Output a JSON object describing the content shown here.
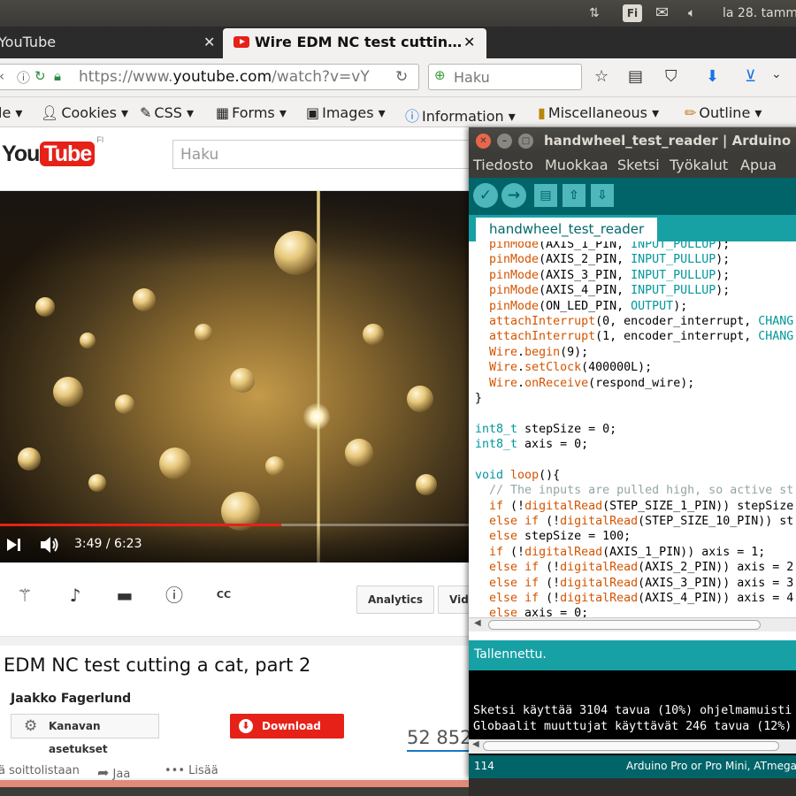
{
  "top_panel": {
    "keyboard_layout": "Fi",
    "clock": "la 28. tamm",
    "icons": [
      "network-arrows-icon",
      "mail-icon",
      "volume-icon"
    ]
  },
  "browser": {
    "tabs": [
      {
        "label": "YouTube",
        "active": false
      },
      {
        "label": "Wire EDM NC test cuttin…",
        "active": true
      }
    ],
    "url_prefix": "https://www.",
    "url_domain": "youtube.com",
    "url_rest": "/watch?v=vY",
    "search_placeholder": "Haku",
    "dev_toolbar": [
      {
        "label": "le",
        "icon": ""
      },
      {
        "label": "Cookies",
        "icon": "cookie-icon"
      },
      {
        "label": "CSS",
        "icon": "css-icon"
      },
      {
        "label": "Forms",
        "icon": "forms-icon"
      },
      {
        "label": "Images",
        "icon": "images-icon"
      },
      {
        "label": "Information",
        "icon": "info-icon"
      },
      {
        "label": "Miscellaneous",
        "icon": "misc-icon"
      },
      {
        "label": "Outline",
        "icon": "outline-icon"
      }
    ]
  },
  "youtube": {
    "logo_you": "You",
    "logo_tube": "Tube",
    "logo_region": "FI",
    "search_placeholder": "Haku",
    "player": {
      "time": "3:49 / 6:23",
      "progress_fraction": 0.6
    },
    "action_buttons": {
      "analytics": "Analytics",
      "video_partial": "Vide"
    },
    "video_title": "EDM NC test cutting a cat, part 2",
    "channel_name": "Jaakko Fagerlund",
    "channel_settings": "Kanavan asetukset",
    "download": "Download",
    "view_count": "52 852",
    "bottom_actions": {
      "playlist": "ä soittolistaan",
      "share": "Jaa",
      "more": "Lisää"
    },
    "accent_color": "#e62117"
  },
  "arduino": {
    "window_title": "handwheel_test_reader | Arduino",
    "menu": [
      "Tiedosto",
      "Muokkaa",
      "Sketsi",
      "Työkalut",
      "Apua"
    ],
    "tab_name": "handwheel_test_reader",
    "code_lines": [
      [
        {
          "t": "  "
        },
        {
          "t": "pinMode",
          "c": "fn"
        },
        {
          "t": "(AXIS_1_PIN, "
        },
        {
          "t": "INPUT_PULLUP",
          "c": "kw"
        },
        {
          "t": ");"
        }
      ],
      [
        {
          "t": "  "
        },
        {
          "t": "pinMode",
          "c": "fn"
        },
        {
          "t": "(AXIS_2_PIN, "
        },
        {
          "t": "INPUT_PULLUP",
          "c": "kw"
        },
        {
          "t": ");"
        }
      ],
      [
        {
          "t": "  "
        },
        {
          "t": "pinMode",
          "c": "fn"
        },
        {
          "t": "(AXIS_3_PIN, "
        },
        {
          "t": "INPUT_PULLUP",
          "c": "kw"
        },
        {
          "t": ");"
        }
      ],
      [
        {
          "t": "  "
        },
        {
          "t": "pinMode",
          "c": "fn"
        },
        {
          "t": "(AXIS_4_PIN, "
        },
        {
          "t": "INPUT_PULLUP",
          "c": "kw"
        },
        {
          "t": ");"
        }
      ],
      [
        {
          "t": "  "
        },
        {
          "t": "pinMode",
          "c": "fn"
        },
        {
          "t": "(ON_LED_PIN, "
        },
        {
          "t": "OUTPUT",
          "c": "kw"
        },
        {
          "t": ");"
        }
      ],
      [
        {
          "t": "  "
        },
        {
          "t": "attachInterrupt",
          "c": "fn"
        },
        {
          "t": "(0, encoder_interrupt, "
        },
        {
          "t": "CHANG",
          "c": "kw"
        }
      ],
      [
        {
          "t": "  "
        },
        {
          "t": "attachInterrupt",
          "c": "fn"
        },
        {
          "t": "(1, encoder_interrupt, "
        },
        {
          "t": "CHANG",
          "c": "kw"
        }
      ],
      [
        {
          "t": "  "
        },
        {
          "t": "Wire",
          "c": "fn"
        },
        {
          "t": "."
        },
        {
          "t": "begin",
          "c": "fn"
        },
        {
          "t": "(9);"
        }
      ],
      [
        {
          "t": "  "
        },
        {
          "t": "Wire",
          "c": "fn"
        },
        {
          "t": "."
        },
        {
          "t": "setClock",
          "c": "fn"
        },
        {
          "t": "(400000L);"
        }
      ],
      [
        {
          "t": "  "
        },
        {
          "t": "Wire",
          "c": "fn"
        },
        {
          "t": "."
        },
        {
          "t": "onReceive",
          "c": "fn"
        },
        {
          "t": "(respond_wire);"
        }
      ],
      [
        {
          "t": "}"
        }
      ],
      [
        {
          "t": ""
        }
      ],
      [
        {
          "t": "int8_t",
          "c": "kw"
        },
        {
          "t": " stepSize = 0;"
        }
      ],
      [
        {
          "t": "int8_t",
          "c": "kw"
        },
        {
          "t": " axis = 0;"
        }
      ],
      [
        {
          "t": ""
        }
      ],
      [
        {
          "t": "void",
          "c": "kw"
        },
        {
          "t": " "
        },
        {
          "t": "loop",
          "c": "fn"
        },
        {
          "t": "(){"
        }
      ],
      [
        {
          "t": "  "
        },
        {
          "t": "// The inputs are pulled high, so active st",
          "c": "cm"
        }
      ],
      [
        {
          "t": "  "
        },
        {
          "t": "if",
          "c": "fn"
        },
        {
          "t": " (!"
        },
        {
          "t": "digitalRead",
          "c": "fn"
        },
        {
          "t": "(STEP_SIZE_1_PIN)) stepSize"
        }
      ],
      [
        {
          "t": "  "
        },
        {
          "t": "else",
          "c": "fn"
        },
        {
          "t": " "
        },
        {
          "t": "if",
          "c": "fn"
        },
        {
          "t": " (!"
        },
        {
          "t": "digitalRead",
          "c": "fn"
        },
        {
          "t": "(STEP_SIZE_10_PIN)) st"
        }
      ],
      [
        {
          "t": "  "
        },
        {
          "t": "else",
          "c": "fn"
        },
        {
          "t": " stepSize = 100;"
        }
      ],
      [
        {
          "t": "  "
        },
        {
          "t": "if",
          "c": "fn"
        },
        {
          "t": " (!"
        },
        {
          "t": "digitalRead",
          "c": "fn"
        },
        {
          "t": "(AXIS_1_PIN)) axis = 1;"
        }
      ],
      [
        {
          "t": "  "
        },
        {
          "t": "else",
          "c": "fn"
        },
        {
          "t": " "
        },
        {
          "t": "if",
          "c": "fn"
        },
        {
          "t": " (!"
        },
        {
          "t": "digitalRead",
          "c": "fn"
        },
        {
          "t": "(AXIS_2_PIN)) axis = 2"
        }
      ],
      [
        {
          "t": "  "
        },
        {
          "t": "else",
          "c": "fn"
        },
        {
          "t": " "
        },
        {
          "t": "if",
          "c": "fn"
        },
        {
          "t": " (!"
        },
        {
          "t": "digitalRead",
          "c": "fn"
        },
        {
          "t": "(AXIS_3_PIN)) axis = 3"
        }
      ],
      [
        {
          "t": "  "
        },
        {
          "t": "else",
          "c": "fn"
        },
        {
          "t": " "
        },
        {
          "t": "if",
          "c": "fn"
        },
        {
          "t": " (!"
        },
        {
          "t": "digitalRead",
          "c": "fn"
        },
        {
          "t": "(AXIS_4_PIN)) axis = 4"
        }
      ],
      [
        {
          "t": "  "
        },
        {
          "t": "else",
          "c": "fn"
        },
        {
          "t": " axis = 0;"
        }
      ]
    ],
    "status_message": "Tallennettu.",
    "console_lines": [
      "Sketsi käyttää 3104 tavua (10%) ohjelmamuisti",
      "Globaalit muuttujat käyttävät 246 tavua (12%)"
    ],
    "footer_line": "114",
    "footer_board": "Arduino Pro or Pro Mini, ATmega3",
    "teal_color": "#00979c"
  }
}
